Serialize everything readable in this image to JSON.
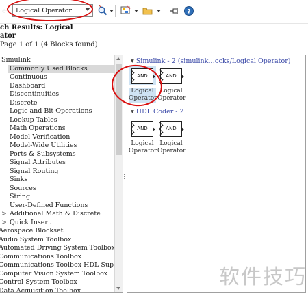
{
  "toolbar": {
    "search_value": "Logical Operator",
    "icons": [
      "back-arrow-icon",
      "search-magnifier-icon",
      "block-library-icon",
      "folder-icon",
      "pin-icon",
      "help-icon"
    ]
  },
  "results": {
    "title": "ch Results: Logical\nator",
    "page_info": "Page 1 of 1 (4 Blocks found)"
  },
  "tree": {
    "items": [
      {
        "label": "Simulink",
        "toggle": ""
      },
      {
        "label": "Commonly Used Blocks",
        "toggle": "",
        "selected": true
      },
      {
        "label": "Continuous",
        "toggle": ""
      },
      {
        "label": "Dashboard",
        "toggle": ""
      },
      {
        "label": "Discontinuities",
        "toggle": ""
      },
      {
        "label": "Discrete",
        "toggle": ""
      },
      {
        "label": "Logic and Bit Operations",
        "toggle": ""
      },
      {
        "label": "Lookup Tables",
        "toggle": ""
      },
      {
        "label": "Math Operations",
        "toggle": ""
      },
      {
        "label": "Model Verification",
        "toggle": ""
      },
      {
        "label": "Model-Wide Utilities",
        "toggle": ""
      },
      {
        "label": "Ports & Subsystems",
        "toggle": ""
      },
      {
        "label": "Signal Attributes",
        "toggle": ""
      },
      {
        "label": "Signal Routing",
        "toggle": ""
      },
      {
        "label": "Sinks",
        "toggle": ""
      },
      {
        "label": "Sources",
        "toggle": ""
      },
      {
        "label": "String",
        "toggle": ""
      },
      {
        "label": "User-Defined Functions",
        "toggle": ""
      },
      {
        "label": "Additional Math & Discrete",
        "toggle": ">"
      },
      {
        "label": "Quick Insert",
        "toggle": ">"
      },
      {
        "label": "Aerospace Blockset",
        "toggle": ""
      },
      {
        "label": "Audio System Toolbox",
        "toggle": ""
      },
      {
        "label": "Automated Driving System Toolbox",
        "toggle": ""
      },
      {
        "label": "Communications Toolbox",
        "toggle": ""
      },
      {
        "label": "Communications Toolbox HDL Support",
        "toggle": ""
      },
      {
        "label": "Computer Vision System Toolbox",
        "toggle": ""
      },
      {
        "label": "Control System Toolbox",
        "toggle": ""
      },
      {
        "label": "Data Acquisition Toolbox",
        "toggle": ""
      }
    ]
  },
  "groups": [
    {
      "header": "Simulink - 2 (simulink…ocks/Logical Operator)",
      "blocks": [
        {
          "icon_text": "AND",
          "name": "Logical\nOperator"
        },
        {
          "icon_text": "AND",
          "name": "Logical\nOperator"
        }
      ]
    },
    {
      "header": "HDL Coder - 2",
      "blocks": [
        {
          "icon_text": "AND",
          "name": "Logical\nOperator"
        },
        {
          "icon_text": "AND",
          "name": "Logical\nOperator"
        }
      ]
    }
  ],
  "watermark": "软件技巧",
  "colors": {
    "annotation_red": "#d90f0f",
    "group_header_blue": "#3b4aa8",
    "selection_gray": "#d9d9d9",
    "block_highlight": "#cfe3f4"
  }
}
